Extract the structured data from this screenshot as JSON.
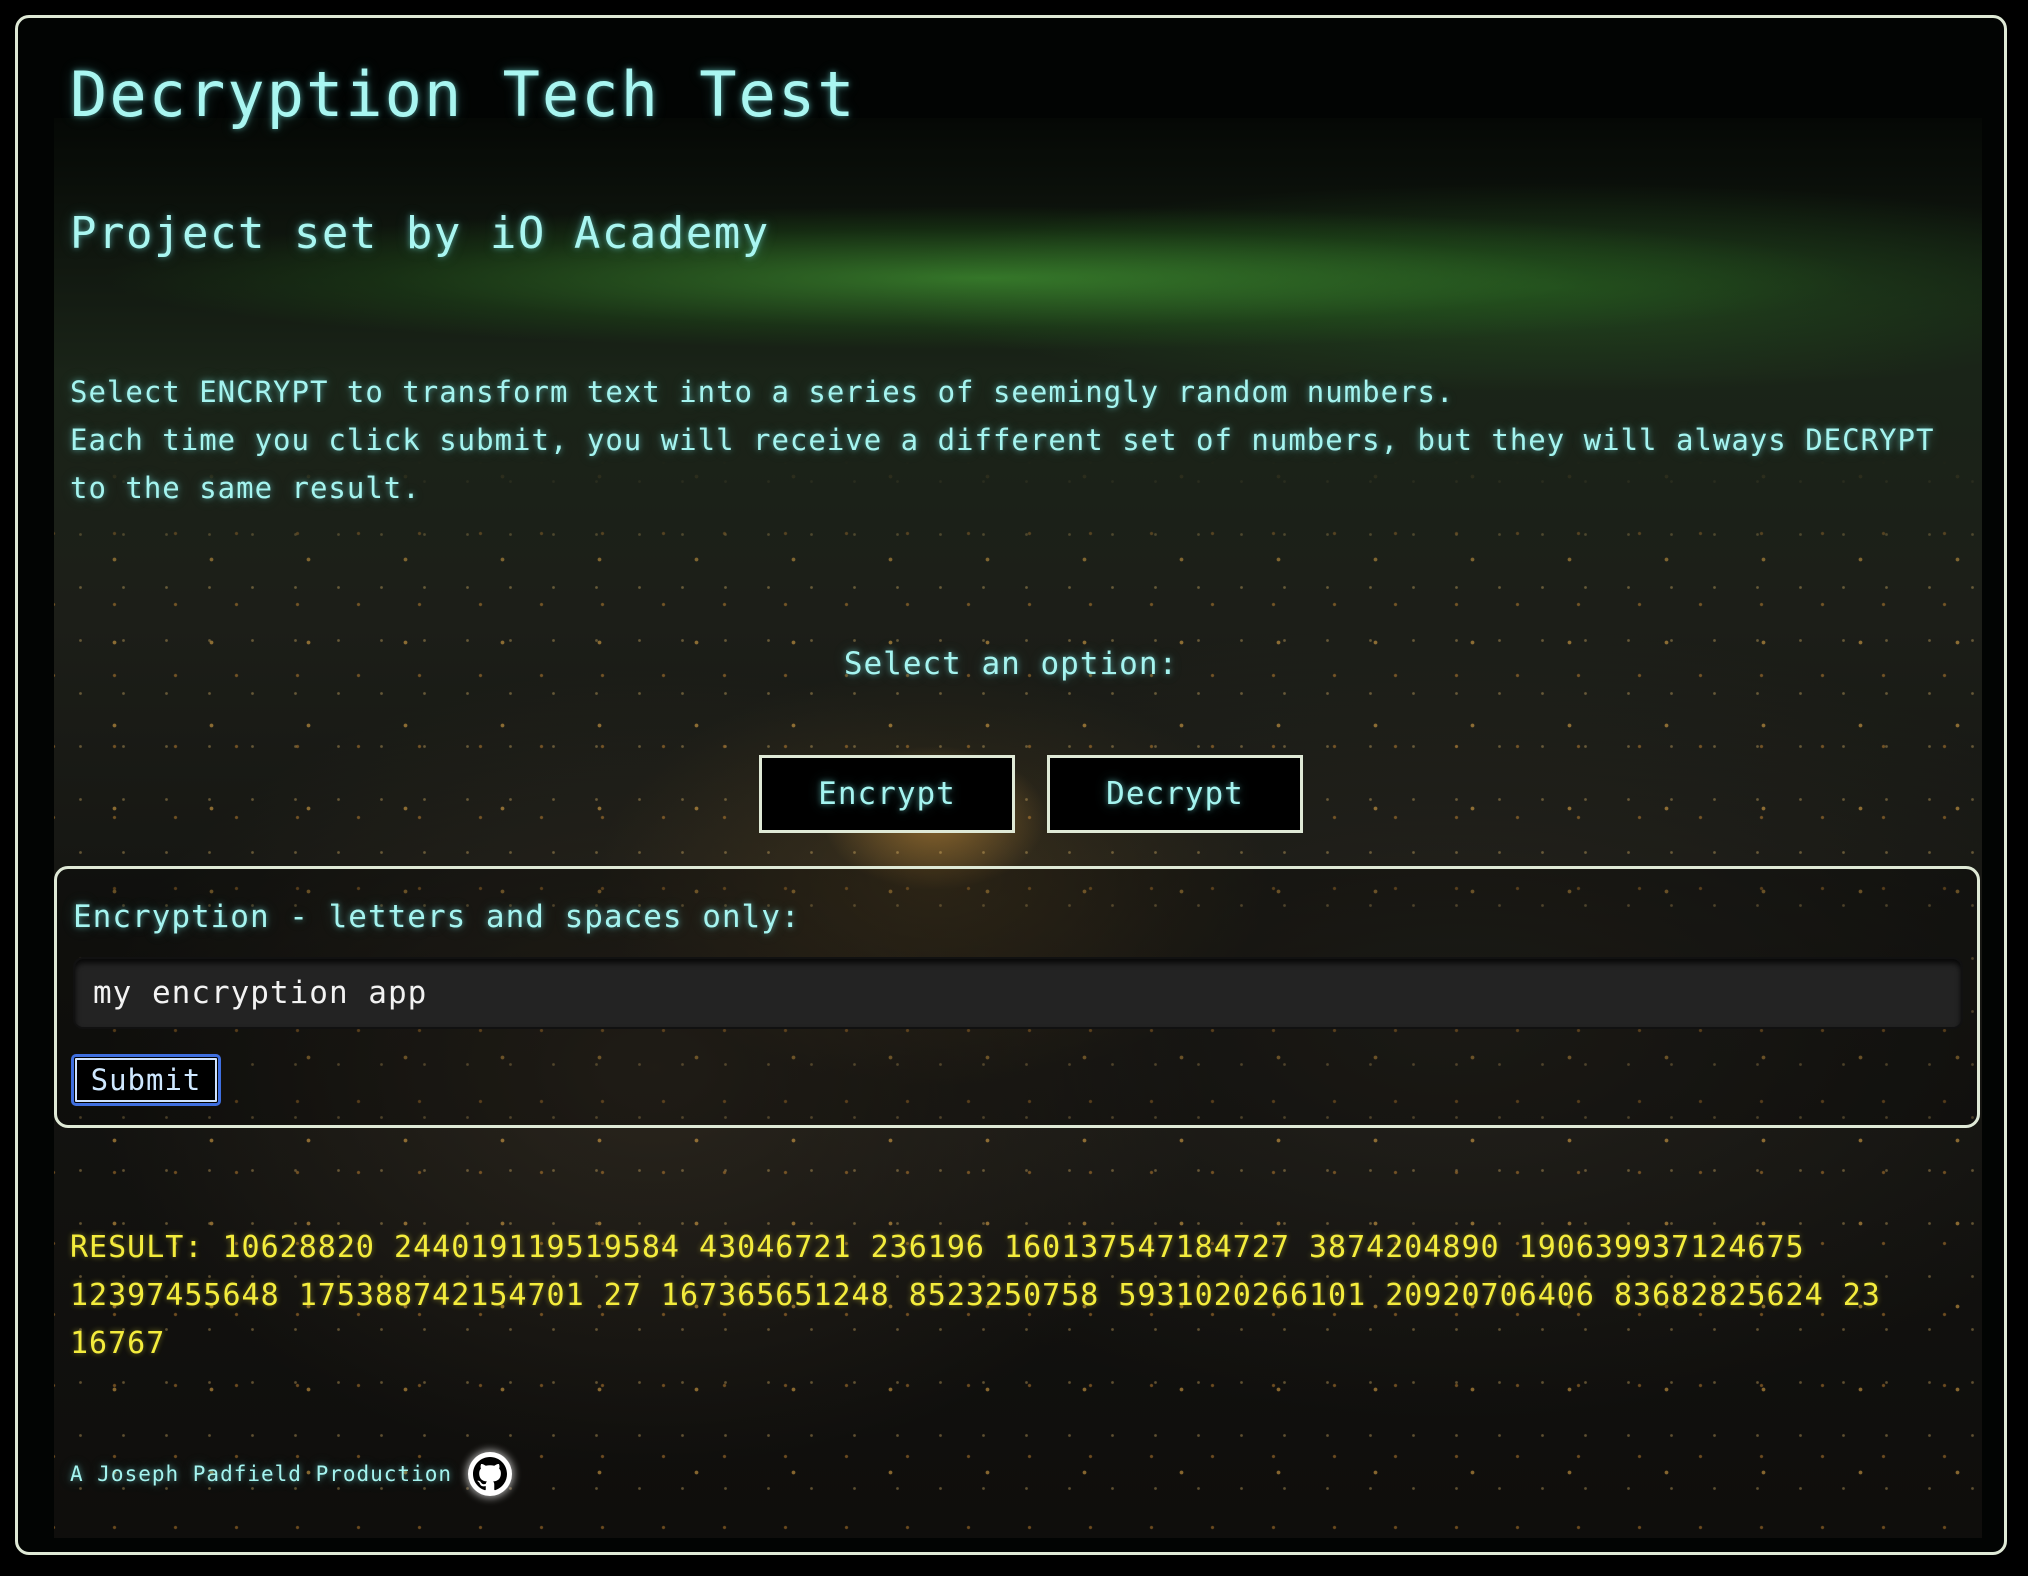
{
  "page": {
    "title": "Decryption Tech Test",
    "subtitle": "Project set by iO Academy",
    "intro": [
      "Select ENCRYPT to transform text into a series of seemingly random numbers.",
      "Each time you click submit, you will receive a different set of numbers, but they will always DECRYPT to the same result."
    ]
  },
  "options": {
    "prompt": "Select an option:",
    "encrypt_label": "Encrypt",
    "decrypt_label": "Decrypt"
  },
  "form": {
    "label": "Encryption - letters and spaces only:",
    "input_value": "my encryption app",
    "submit_label": "Submit"
  },
  "result": {
    "text": "RESULT: 10628820 244019119519584 43046721 236196 160137547184727 3874204890 190639937124675 12397455648 175388742154701 27 167365651248 8523250758 5931020266101 20920706406 83682825624 23 16767"
  },
  "footer": {
    "credit": "A Joseph Padfield Production",
    "github_icon": "github-icon"
  },
  "colors": {
    "text_cyan": "#a5f4f0",
    "result_yellow": "#f4ec3c",
    "border": "#dfe9d6",
    "submit_border": "#3f6fe0"
  }
}
